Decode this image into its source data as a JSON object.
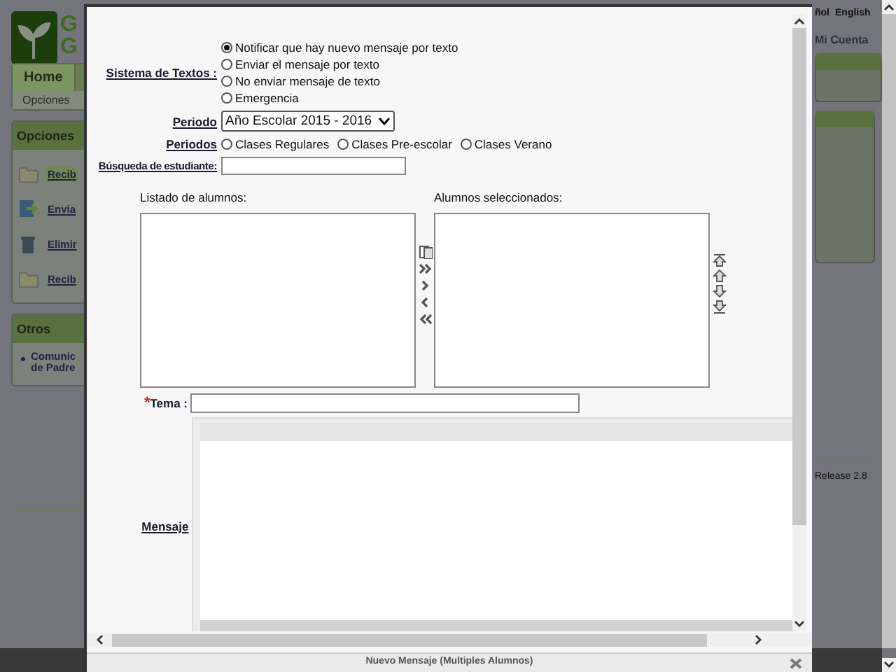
{
  "background": {
    "logo_letters": [
      "G",
      "G"
    ],
    "nav": {
      "tabs": [
        {
          "label": "Home",
          "selected": true
        }
      ],
      "subnav": "Opciones"
    },
    "options_panel": {
      "title": "Opciones",
      "items": [
        {
          "label": "Recib",
          "kind": "folder",
          "selected": true
        },
        {
          "label": "Envia",
          "kind": "send",
          "selected": false
        },
        {
          "label": "Elimir",
          "kind": "trash",
          "selected": false
        },
        {
          "label": "Recib",
          "kind": "folder",
          "selected": false
        }
      ]
    },
    "other_panel": {
      "title": "Otros",
      "items": [
        {
          "lines": [
            "Comunic",
            "de Padre"
          ]
        }
      ]
    },
    "language_links": [
      "ñol",
      "English"
    ],
    "account_link": "Mi Cuenta",
    "release": "Release 2.8"
  },
  "dialog": {
    "title": "Nuevo Mensaje (Multiples Alumnos)",
    "sms_label": "Sistema de Textos :",
    "sms_options": [
      {
        "label": "Notificar que hay nuevo mensaje por texto",
        "selected": true
      },
      {
        "label": "Enviar el mensaje por texto",
        "selected": false
      },
      {
        "label": "No enviar mensaje de texto",
        "selected": false
      },
      {
        "label": "Emergencia",
        "selected": false
      }
    ],
    "period_label": "Periodo",
    "period_value": "Año Escolar 2015 - 2016",
    "periods_label": "Periodos",
    "periods": [
      {
        "label": "Clases Regulares",
        "selected": false
      },
      {
        "label": "Clases Pre-escolar",
        "selected": false
      },
      {
        "label": "Clases Verano",
        "selected": false
      }
    ],
    "search_label": "Búsqueda de estudiante:",
    "available_label": "Listado de alumnos:",
    "selected_label": "Alumnos seleccionados:",
    "subject_required": "*",
    "subject_label": "Tema :",
    "message_label": "Mensaje"
  }
}
